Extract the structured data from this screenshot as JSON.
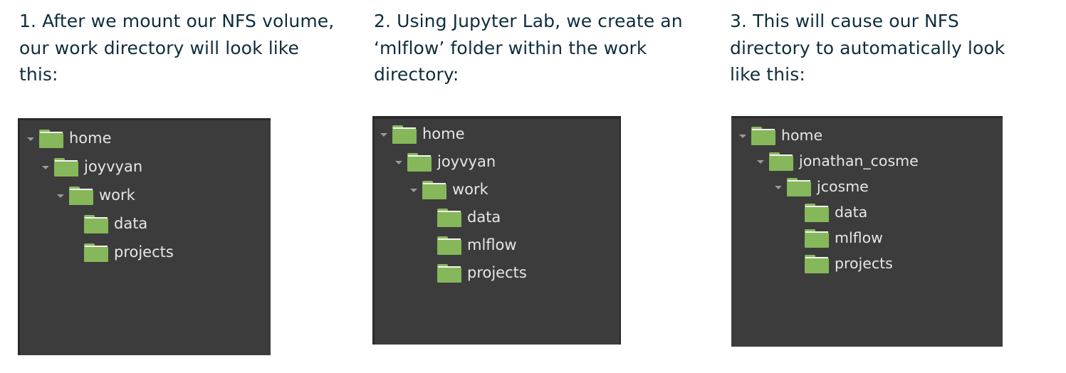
{
  "steps": [
    {
      "caption": "1. After we mount our NFS volume,\nour work directory will look like\nthis:",
      "tree": [
        {
          "label": "home",
          "depth": 0,
          "expanded": true,
          "icon": "folder-icon"
        },
        {
          "label": "joyvyan",
          "depth": 1,
          "expanded": true,
          "icon": "folder-icon"
        },
        {
          "label": "work",
          "depth": 2,
          "expanded": true,
          "icon": "folder-icon"
        },
        {
          "label": "data",
          "depth": 3,
          "expanded": false,
          "icon": "folder-icon"
        },
        {
          "label": "projects",
          "depth": 3,
          "expanded": false,
          "icon": "folder-icon"
        }
      ]
    },
    {
      "caption": "2. Using Jupyter Lab, we create an\n‘mlflow’ folder within the work\ndirectory:",
      "tree": [
        {
          "label": "home",
          "depth": 0,
          "expanded": true,
          "icon": "folder-icon"
        },
        {
          "label": "joyvyan",
          "depth": 1,
          "expanded": true,
          "icon": "folder-icon"
        },
        {
          "label": "work",
          "depth": 2,
          "expanded": true,
          "icon": "folder-icon"
        },
        {
          "label": "data",
          "depth": 3,
          "expanded": false,
          "icon": "folder-icon"
        },
        {
          "label": "mlflow",
          "depth": 3,
          "expanded": false,
          "icon": "folder-icon"
        },
        {
          "label": "projects",
          "depth": 3,
          "expanded": false,
          "icon": "folder-icon"
        }
      ]
    },
    {
      "caption": "3. This will cause our NFS\ndirectory to automatically look\nlike this:",
      "tree": [
        {
          "label": "home",
          "depth": 0,
          "expanded": true,
          "icon": "folder-icon"
        },
        {
          "label": "jonathan_cosme",
          "depth": 1,
          "expanded": true,
          "icon": "folder-icon"
        },
        {
          "label": "jcosme",
          "depth": 2,
          "expanded": true,
          "icon": "folder-icon"
        },
        {
          "label": "data",
          "depth": 3,
          "expanded": false,
          "icon": "folder-icon"
        },
        {
          "label": "mlflow",
          "depth": 3,
          "expanded": false,
          "icon": "folder-icon"
        },
        {
          "label": "projects",
          "depth": 3,
          "expanded": false,
          "icon": "folder-icon"
        }
      ]
    }
  ],
  "colors": {
    "caption_text": "#0f2e3d",
    "panel_bg": "#3c3c3c",
    "folder_green": "#86b75a",
    "node_text": "#e6e6e6",
    "expander_arrow": "#9a9a9a"
  }
}
